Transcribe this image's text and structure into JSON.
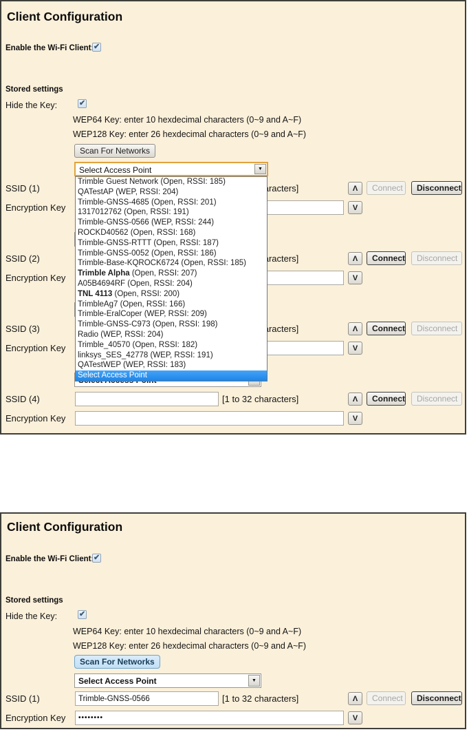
{
  "colors": {
    "panel_bg": "#fbf0da",
    "panel_border": "#3f3e39",
    "selection_blue": "#2e95f5",
    "scan_active_bg": "#cbe4f8",
    "combo_focus_border": "#e1a33c"
  },
  "strings": {
    "title": "Client Configuration",
    "enable_label": "Enable the Wi-Fi Client:",
    "stored_settings": "Stored settings",
    "hide_key_label": "Hide the Key:",
    "wep64_hint": "WEP64 Key: enter 10 hexdecimal characters (0~9 and A~F)",
    "wep128_hint": "WEP128 Key: enter 26 hexdecimal characters (0~9 and A~F)",
    "scan_button": "Scan For Networks",
    "select_access_point": "Select Access Point",
    "chars_hint": "[1 to 32 characters]",
    "encryption_key": "Encryption Key",
    "connect": "Connect",
    "disconnect": "Disconnect",
    "up_glyph": "Λ",
    "down_glyph": "V",
    "dropdown_arrow": "▼"
  },
  "top_panel": {
    "enable_checked": true,
    "hide_key_checked": true,
    "dropdown_open": true,
    "groups": [
      {
        "label": "SSID (1)",
        "ssid_value": "",
        "key_value": "",
        "connect_enabled": false,
        "disconnect_enabled": true
      },
      {
        "label": "SSID (2)",
        "ssid_value": "",
        "key_value": "",
        "connect_enabled": true,
        "disconnect_enabled": false
      },
      {
        "label": "SSID (3)",
        "ssid_value": "",
        "key_value": "",
        "connect_enabled": true,
        "disconnect_enabled": false
      },
      {
        "label": "SSID (4)",
        "ssid_value": "",
        "key_value": "",
        "connect_enabled": true,
        "disconnect_enabled": false
      }
    ],
    "ap_list": [
      {
        "name": "Trimble Guest Network",
        "detail": " (Open, RSSI: 185)",
        "bold": false,
        "selected": false
      },
      {
        "name": "QATestAP",
        "detail": " (WEP, RSSI: 204)",
        "bold": false,
        "selected": false
      },
      {
        "name": "Trimble-GNSS-4685",
        "detail": " (Open, RSSI: 201)",
        "bold": false,
        "selected": false
      },
      {
        "name": "1317012762",
        "detail": " (Open, RSSI: 191)",
        "bold": false,
        "selected": false
      },
      {
        "name": "Trimble-GNSS-0566",
        "detail": " (WEP, RSSI: 244)",
        "bold": false,
        "selected": false
      },
      {
        "name": "ROCKD40562",
        "detail": " (Open, RSSI: 168)",
        "bold": false,
        "selected": false
      },
      {
        "name": "Trimble-GNSS-RTTT",
        "detail": " (Open, RSSI: 187)",
        "bold": false,
        "selected": false
      },
      {
        "name": "Trimble-GNSS-0052",
        "detail": " (Open, RSSI: 186)",
        "bold": false,
        "selected": false
      },
      {
        "name": "Trimble-Base-KQROCK6724",
        "detail": " (Open, RSSI: 185)",
        "bold": false,
        "selected": false
      },
      {
        "name": "Trimble Alpha",
        "detail": " (Open, RSSI: 207)",
        "bold": true,
        "selected": false
      },
      {
        "name": "A05B4694RF",
        "detail": " (Open, RSSI: 204)",
        "bold": false,
        "selected": false
      },
      {
        "name": "TNL 4113",
        "detail": " (Open, RSSI: 200)",
        "bold": true,
        "selected": false
      },
      {
        "name": "TrimbleAg7",
        "detail": " (Open, RSSI: 166)",
        "bold": false,
        "selected": false
      },
      {
        "name": "Trimble-EralCoper",
        "detail": " (WEP, RSSI: 209)",
        "bold": false,
        "selected": false
      },
      {
        "name": "Trimble-GNSS-C973",
        "detail": " (Open, RSSI: 198)",
        "bold": false,
        "selected": false
      },
      {
        "name": "Radio",
        "detail": " (WEP, RSSI: 204)",
        "bold": false,
        "selected": false
      },
      {
        "name": "Trimble_40570",
        "detail": " (Open, RSSI: 182)",
        "bold": false,
        "selected": false
      },
      {
        "name": "linksys_SES_42778",
        "detail": " (WEP, RSSI: 191)",
        "bold": false,
        "selected": false
      },
      {
        "name": "QATestWEP",
        "detail": " (WEP, RSSI: 183)",
        "bold": false,
        "selected": false
      },
      {
        "name": "Select Access Point",
        "detail": "",
        "bold": false,
        "selected": true
      }
    ]
  },
  "bottom_panel": {
    "enable_checked": true,
    "hide_key_checked": true,
    "dropdown_open": false,
    "group": {
      "label": "SSID (1)",
      "ssid_value": "Trimble-GNSS-0566",
      "key_value": "••••••••",
      "connect_enabled": false,
      "disconnect_enabled": true
    }
  }
}
